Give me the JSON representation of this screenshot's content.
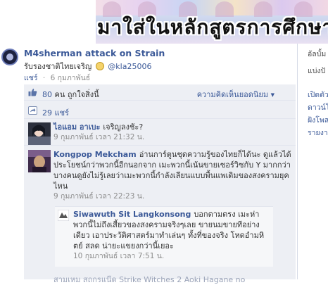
{
  "banner": {
    "text": "มาใส่ในหลักสูตรการศึกษาไทย"
  },
  "post": {
    "author": "M4sherman attack on Strain",
    "body": "รับรองชาติไทยเจริญ",
    "mention": "@kla25006",
    "share_link": "แชร์",
    "date": "6 กุมภาพันธ์"
  },
  "right_column": {
    "line1": "อัลบั้ม",
    "line2": "แบ่งปั",
    "line3": "เปิดตัว",
    "line4": "ดาวน์โ",
    "line5": "ฝังโพส",
    "line6": "รายงา"
  },
  "feedback": {
    "likes_count": "80",
    "likes_text": "คน ถูกใจสิ่งนี้",
    "sort_label": "ความคิดเห็นยอดนิยม",
    "shares_text": "29 แชร์"
  },
  "comments": [
    {
      "author": "ไอแอม อาเบะ",
      "text": "เจริญลงช้ะ?",
      "date": "9 กุมภาพันธ์",
      "time_prefix": "เวลา",
      "time": "21:32 น."
    },
    {
      "author": "Kongpop Mekcham",
      "text": "อ่านการ์ตูนชุดความรู้ของไทยก็ได้นะ ดูแล้วได้ประโยชน์กว่าพวกนี้อีกนอกจาก เมะพวกนี้เน้นขายเซอร์วิซกับ Y มากกว่า บางคนดูยังไม่รู้เลยว่าเมะพวกนี้กำลังเลียนแบบพื้นแพเดิมของสงครามยุคไหน",
      "date": "9 กุมภาพันธ์",
      "time_prefix": "เวลา",
      "time": "22:23 น."
    }
  ],
  "reply": {
    "author": "Siwawuth Sit Langkonsong",
    "text": "บอกตามตรง เมะห่าพวกนี้ไม่ถึงเสี้ยวของสงครามจริงๆเลย ขายนมขายทีอย่างเดียว เอาประวัติศาสตร์มาทำเล่นๆ ทั้งที่ของจริง โหดอำมหิตย์ สลด น่ายะแขยงกว่านี้เยอะ",
    "date": "10 กุมภาพันธ์",
    "time_prefix": "เวลา",
    "time": "7:51 น."
  },
  "next_comment": {
    "text": "สามเหม สถกรแน๊ด Strike Witches 2 Aoki Hagane no"
  },
  "colors": {
    "link": "#3b5998",
    "feedback_bg": "#edeff4",
    "meta": "#8c8c8c"
  },
  "icons": [
    "thumbs-up-icon",
    "share-icon",
    "chevron-down-icon",
    "smiley-icon",
    "globe-icon"
  ]
}
